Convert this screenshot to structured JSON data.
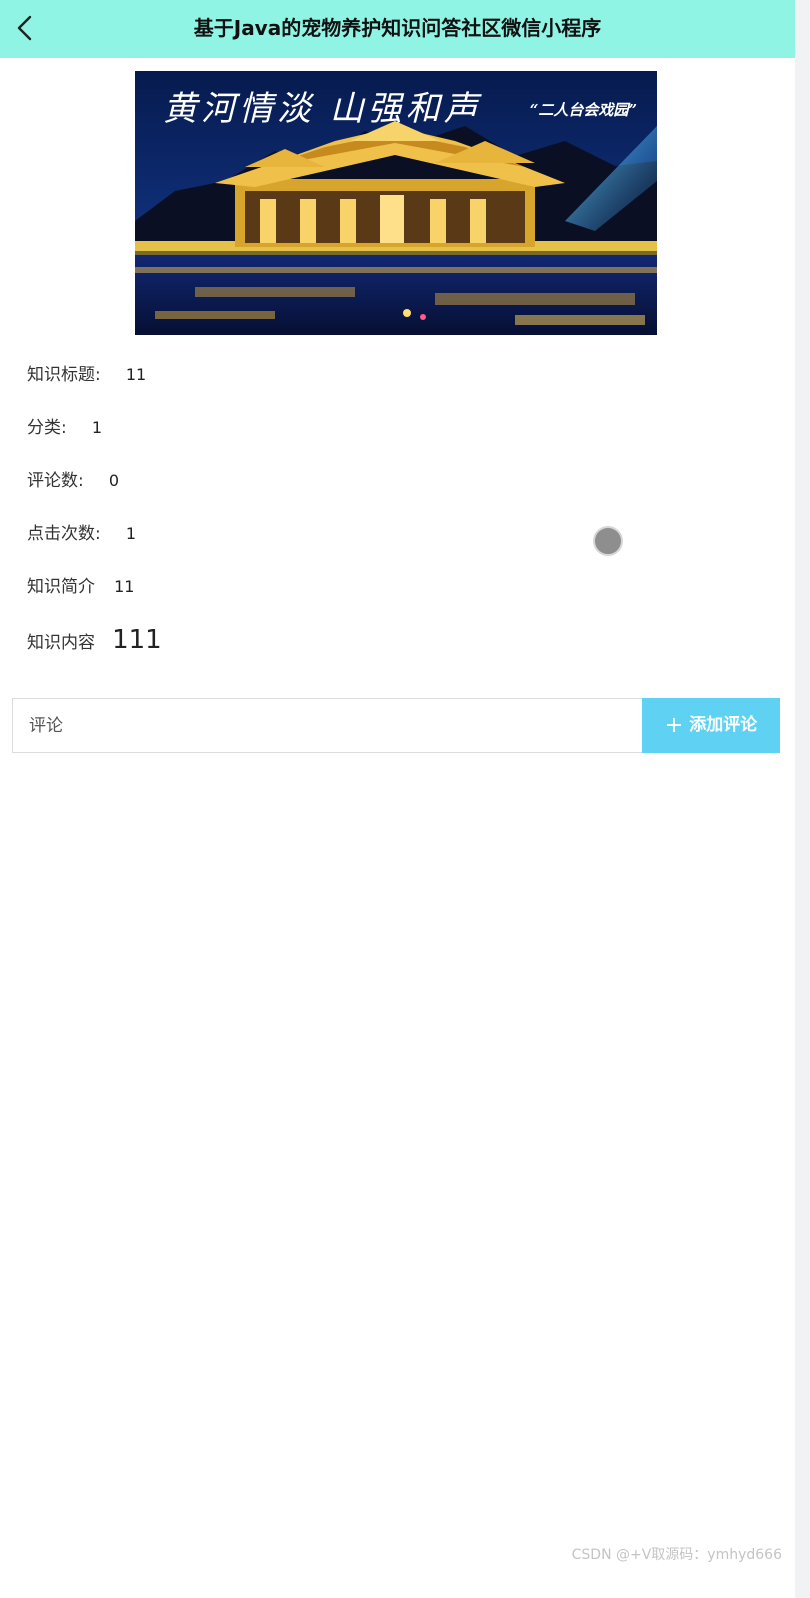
{
  "header": {
    "title": "基于Java的宠物养护知识问答社区微信小程序",
    "back_icon": "chevron-left-icon"
  },
  "hero": {
    "calligraphy": "黄河情淡  山强和声",
    "tag": "“二人台会戏园”"
  },
  "details": {
    "title_label": "知识标题:",
    "title_value": "11",
    "category_label": "分类:",
    "category_value": "1",
    "comments_label": "评论数:",
    "comments_value": "0",
    "clicks_label": "点击次数:",
    "clicks_value": "1",
    "intro_label": "知识简介",
    "intro_value": "11",
    "content_label": "知识内容",
    "content_value": "111"
  },
  "comment": {
    "placeholder": "评论",
    "add_button_label": "添加评论",
    "add_icon": "plus-icon"
  },
  "watermark": "CSDN @+V取源码：ymhyd666",
  "colors": {
    "header_bg": "#8ff4e3",
    "button_bg": "#5fd2f3"
  }
}
